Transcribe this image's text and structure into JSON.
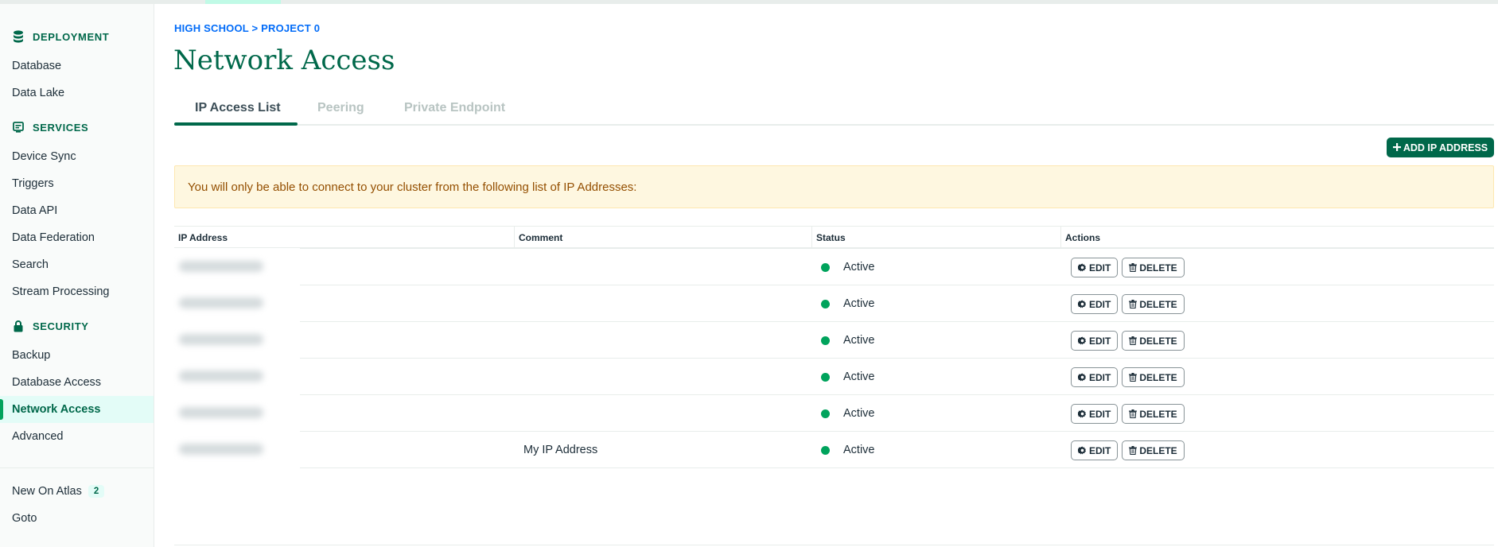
{
  "sidebar": {
    "sections": {
      "deployment": {
        "label": "DEPLOYMENT",
        "icon": "database-icon"
      },
      "services": {
        "label": "SERVICES",
        "icon": "services-icon"
      },
      "security": {
        "label": "SECURITY",
        "icon": "lock-icon"
      }
    },
    "items": {
      "database": "Database",
      "data_lake": "Data Lake",
      "device_sync": "Device Sync",
      "triggers": "Triggers",
      "data_api": "Data API",
      "data_federation": "Data Federation",
      "search": "Search",
      "stream_processing": "Stream Processing",
      "backup": "Backup",
      "database_access": "Database Access",
      "network_access": "Network Access",
      "advanced": "Advanced",
      "new_on_atlas": "New On Atlas",
      "goto": "Goto"
    },
    "new_on_atlas_count": "2",
    "active_item": "network_access"
  },
  "breadcrumb": "HIGH SCHOOL > PROJECT 0",
  "page_title": "Network Access",
  "tabs": [
    {
      "label": "IP Access List",
      "active": true
    },
    {
      "label": "Peering",
      "active": false
    },
    {
      "label": "Private Endpoint",
      "active": false
    }
  ],
  "add_button": {
    "label": "ADD IP ADDRESS",
    "icon": "plus-icon"
  },
  "notice": "You will only be able to connect to your cluster from the following list of IP Addresses:",
  "table": {
    "headers": {
      "ip": "IP Address",
      "comment": "Comment",
      "status": "Status",
      "actions": "Actions"
    },
    "rows": [
      {
        "comment": "",
        "status": "Active"
      },
      {
        "comment": "",
        "status": "Active"
      },
      {
        "comment": "",
        "status": "Active"
      },
      {
        "comment": "",
        "status": "Active"
      },
      {
        "comment": "",
        "status": "Active"
      },
      {
        "comment": "My IP Address",
        "status": "Active"
      }
    ],
    "edit_label": "EDIT",
    "delete_label": "DELETE"
  },
  "colors": {
    "brand_green": "#00684a",
    "status_active": "#00a35c",
    "link_blue": "#016bf8",
    "notice_bg": "#fef7e0",
    "notice_text": "#944f01"
  }
}
